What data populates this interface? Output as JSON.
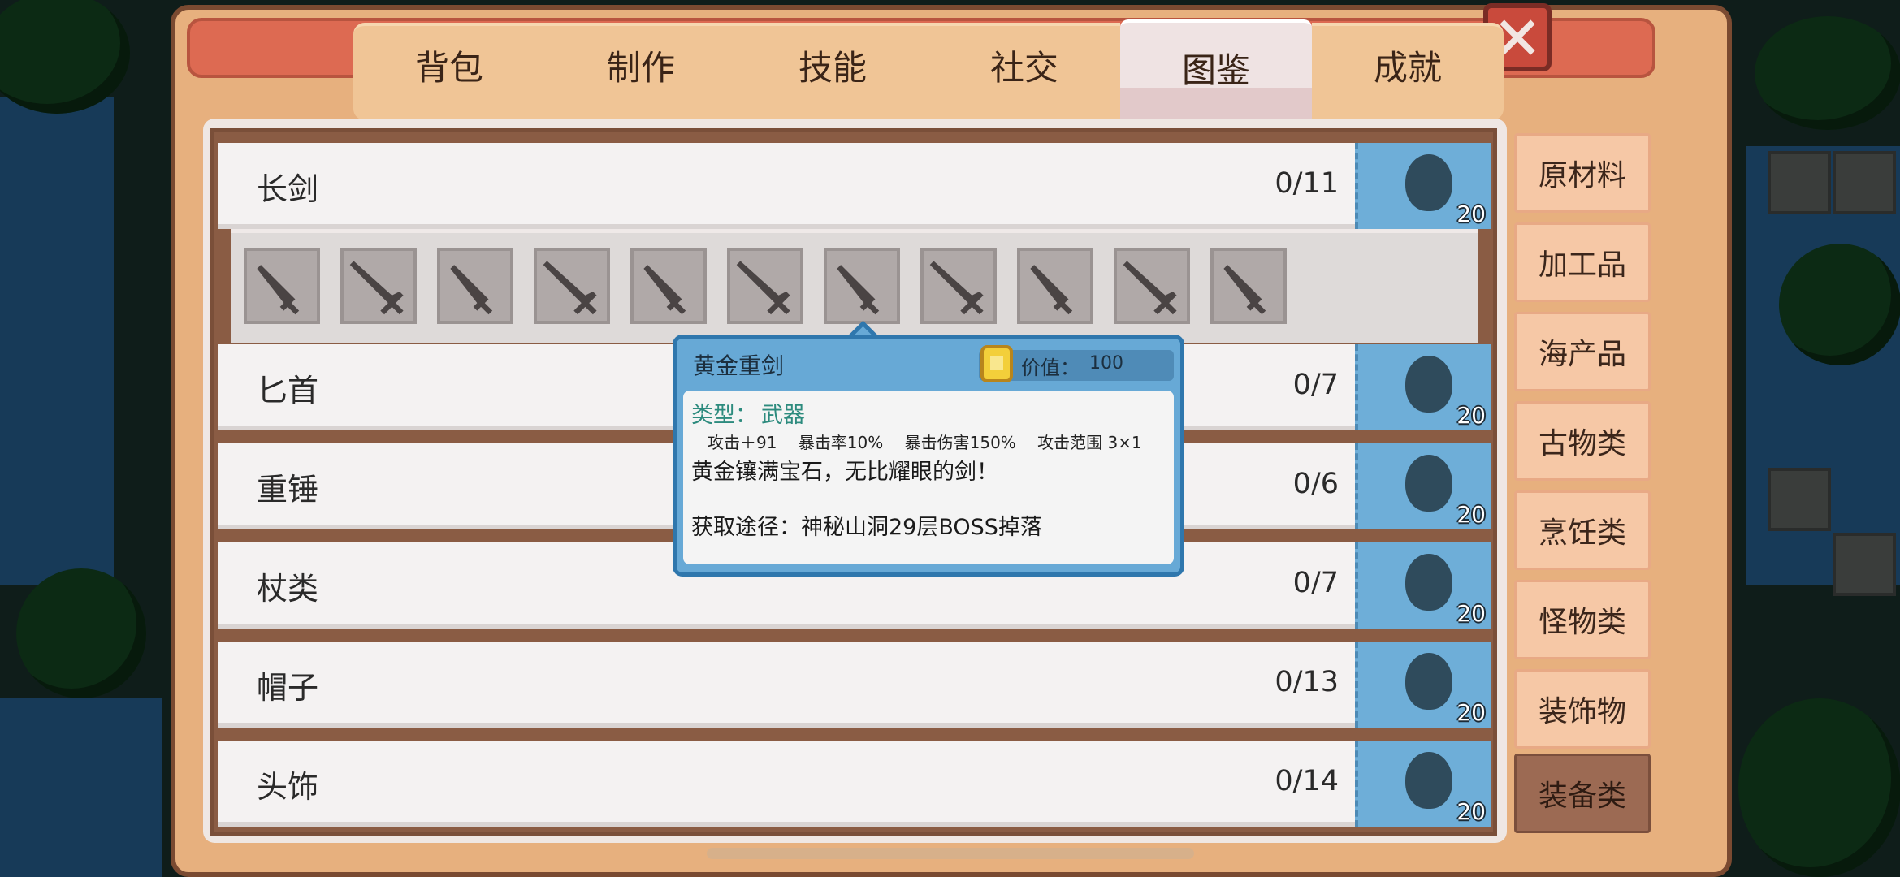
{
  "tabs": [
    "背包",
    "制作",
    "技能",
    "社交",
    "图鉴",
    "成就"
  ],
  "active_tab": "图鉴",
  "categories": [
    {
      "name": "长剑",
      "count": "0/11",
      "reward": "20"
    },
    {
      "name": "匕首",
      "count": "0/7",
      "reward": "20"
    },
    {
      "name": "重锤",
      "count": "0/6",
      "reward": "20"
    },
    {
      "name": "杖类",
      "count": "0/7",
      "reward": "20"
    },
    {
      "name": "帽子",
      "count": "0/13",
      "reward": "20"
    },
    {
      "name": "头饰",
      "count": "0/14",
      "reward": "20"
    }
  ],
  "expanded_item_count": 11,
  "side_categories": [
    "原材料",
    "加工品",
    "海产品",
    "古物类",
    "烹饪类",
    "怪物类",
    "装饰物",
    "装备类"
  ],
  "active_side_category": "装备类",
  "tooltip": {
    "title": "黄金重剑",
    "value_label": "价值：",
    "value": "100",
    "type_label": "类型：",
    "type": "武器",
    "stats": [
      "攻击＋91",
      "暴击率10%",
      "暴击伤害150%",
      "攻击范围 3×1"
    ],
    "description": "黄金镶满宝石，无比耀眼的剑！",
    "source": "获取途径：神秘山洞29层BOSS掉落"
  },
  "colors": {
    "panel": "#e7b07e",
    "reward_blue": "#6eaed8",
    "tooltip_blue": "#67a9d6",
    "active_side": "#9c6a53"
  }
}
